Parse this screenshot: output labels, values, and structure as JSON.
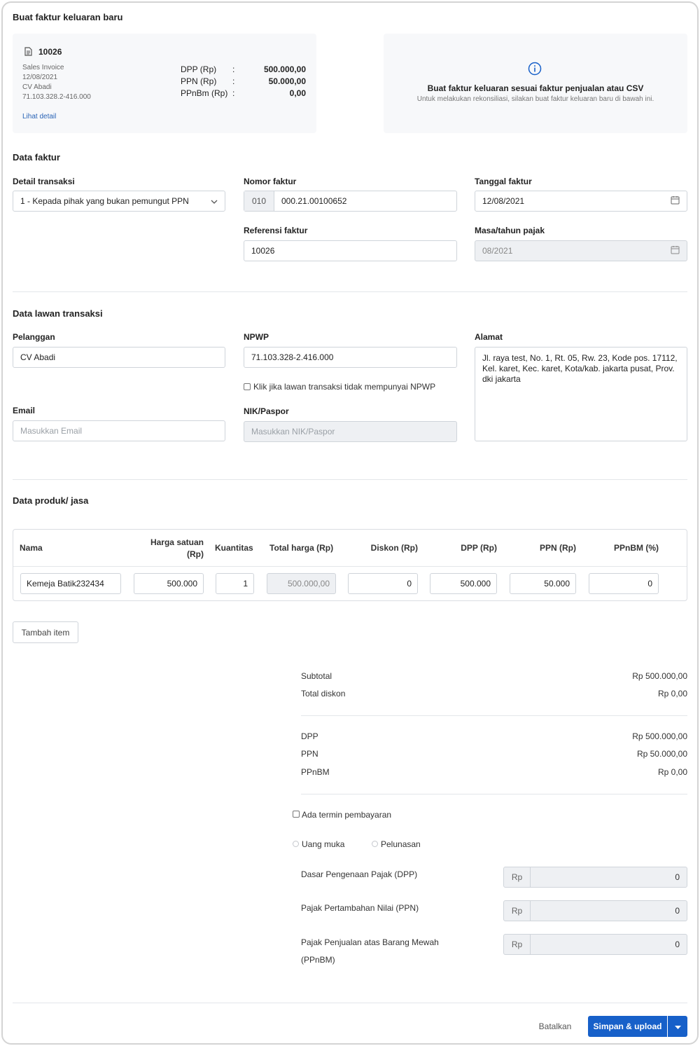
{
  "page": {
    "title": "Buat faktur keluaran baru"
  },
  "invoice_card": {
    "number": "10026",
    "type": "Sales Invoice",
    "date": "12/08/2021",
    "customer": "CV Abadi",
    "npwp": "71.103.328.2-416.000",
    "rows": [
      {
        "label": "DPP (Rp)",
        "sep": ":",
        "value": "500.000,00"
      },
      {
        "label": "PPN (Rp)",
        "sep": ":",
        "value": "50.000,00"
      },
      {
        "label": "PPnBm (Rp)",
        "sep": ":",
        "value": "0,00"
      }
    ],
    "detail_link": "Lihat detail"
  },
  "info_card": {
    "title": "Buat faktur keluaran sesuai faktur penjualan atau CSV",
    "subtitle": "Untuk melakukan rekonsiliasi, silakan buat faktur keluaran baru di bawah ini."
  },
  "data_faktur": {
    "heading": "Data faktur",
    "detail_transaksi_label": "Detail transaksi",
    "detail_transaksi_value": "1 - Kepada pihak yang bukan pemungut PPN",
    "nomor_faktur_label": "Nomor faktur",
    "nomor_prefix": "010",
    "nomor_value": "000.21.00100652",
    "tanggal_label": "Tanggal faktur",
    "tanggal_value": "12/08/2021",
    "referensi_label": "Referensi faktur",
    "referensi_value": "10026",
    "masa_label": "Masa/tahun pajak",
    "masa_value": "08/2021"
  },
  "lawan": {
    "heading": "Data lawan transaksi",
    "pelanggan_label": "Pelanggan",
    "pelanggan_value": "CV Abadi",
    "npwp_label": "NPWP",
    "npwp_value": "71.103.328-2.416.000",
    "npwp_checkbox": "Klik jika lawan transaksi tidak mempunyai NPWP",
    "alamat_label": "Alamat",
    "alamat_value": "Jl. raya test, No. 1, Rt. 05, Rw. 23, Kode pos. 17112, Kel. karet, Kec. karet, Kota/kab. jakarta pusat, Prov. dki jakarta",
    "email_label": "Email",
    "email_placeholder": "Masukkan Email",
    "nik_label": "NIK/Paspor",
    "nik_placeholder": "Masukkan NIK/Paspor"
  },
  "produk": {
    "heading": "Data produk/ jasa",
    "columns": {
      "nama": "Nama",
      "harga_1": "Harga satuan",
      "harga_2": "(Rp)",
      "kuantitas": "Kuantitas",
      "total": "Total harga (Rp)",
      "diskon": "Diskon (Rp)",
      "dpp": "DPP (Rp)",
      "ppn": "PPN (Rp)",
      "ppnbm": "PPnBM (%)"
    },
    "row": {
      "nama": "Kemeja Batik232434",
      "harga": "500.000",
      "kuantitas": "1",
      "total": "500.000,00",
      "diskon": "0",
      "dpp": "500.000",
      "ppn": "50.000",
      "ppnbm": "0"
    },
    "add_button": "Tambah item"
  },
  "summary": {
    "subtotal_label": "Subtotal",
    "subtotal_value": "Rp 500.000,00",
    "diskon_label": "Total diskon",
    "diskon_value": "Rp 0,00",
    "dpp_label": "DPP",
    "dpp_value": "Rp 500.000,00",
    "ppn_label": "PPN",
    "ppn_value": "Rp 50.000,00",
    "ppnbm_label": "PPnBM",
    "ppnbm_value": "Rp 0,00"
  },
  "termin": {
    "checkbox_label": "Ada termin pembayaran",
    "radio_1": "Uang muka",
    "radio_2": "Pelunasan",
    "dpp_label": "Dasar Pengenaan Pajak (DPP)",
    "ppn_label": "Pajak Pertambahan Nilai (PPN)",
    "ppnbm_label_1": "Pajak Penjualan atas Barang Mewah",
    "ppnbm_label_2": "(PPnBM)",
    "prefix": "Rp",
    "dpp_value": "0",
    "ppn_value": "0",
    "ppnbm_value": "0"
  },
  "footer": {
    "cancel": "Batalkan",
    "save": "Simpan & upload"
  },
  "colors": {
    "primary": "#1760c9",
    "link": "#2a64b6",
    "border": "#cfd4da"
  }
}
